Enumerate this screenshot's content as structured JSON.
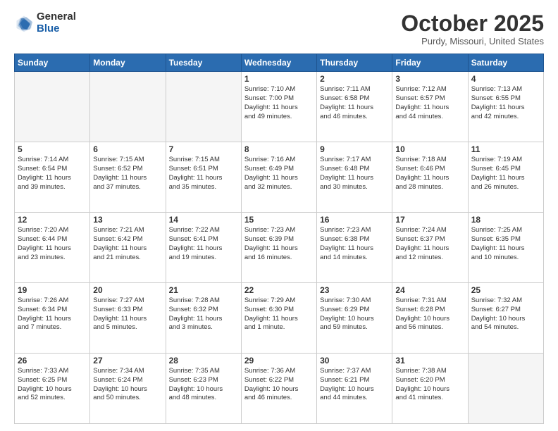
{
  "logo": {
    "general": "General",
    "blue": "Blue"
  },
  "title": "October 2025",
  "location": "Purdy, Missouri, United States",
  "days_of_week": [
    "Sunday",
    "Monday",
    "Tuesday",
    "Wednesday",
    "Thursday",
    "Friday",
    "Saturday"
  ],
  "weeks": [
    [
      {
        "day": "",
        "info": "",
        "empty": true
      },
      {
        "day": "",
        "info": "",
        "empty": true
      },
      {
        "day": "",
        "info": "",
        "empty": true
      },
      {
        "day": "1",
        "info": "Sunrise: 7:10 AM\nSunset: 7:00 PM\nDaylight: 11 hours\nand 49 minutes.",
        "empty": false
      },
      {
        "day": "2",
        "info": "Sunrise: 7:11 AM\nSunset: 6:58 PM\nDaylight: 11 hours\nand 46 minutes.",
        "empty": false
      },
      {
        "day": "3",
        "info": "Sunrise: 7:12 AM\nSunset: 6:57 PM\nDaylight: 11 hours\nand 44 minutes.",
        "empty": false
      },
      {
        "day": "4",
        "info": "Sunrise: 7:13 AM\nSunset: 6:55 PM\nDaylight: 11 hours\nand 42 minutes.",
        "empty": false
      }
    ],
    [
      {
        "day": "5",
        "info": "Sunrise: 7:14 AM\nSunset: 6:54 PM\nDaylight: 11 hours\nand 39 minutes.",
        "empty": false
      },
      {
        "day": "6",
        "info": "Sunrise: 7:15 AM\nSunset: 6:52 PM\nDaylight: 11 hours\nand 37 minutes.",
        "empty": false
      },
      {
        "day": "7",
        "info": "Sunrise: 7:15 AM\nSunset: 6:51 PM\nDaylight: 11 hours\nand 35 minutes.",
        "empty": false
      },
      {
        "day": "8",
        "info": "Sunrise: 7:16 AM\nSunset: 6:49 PM\nDaylight: 11 hours\nand 32 minutes.",
        "empty": false
      },
      {
        "day": "9",
        "info": "Sunrise: 7:17 AM\nSunset: 6:48 PM\nDaylight: 11 hours\nand 30 minutes.",
        "empty": false
      },
      {
        "day": "10",
        "info": "Sunrise: 7:18 AM\nSunset: 6:46 PM\nDaylight: 11 hours\nand 28 minutes.",
        "empty": false
      },
      {
        "day": "11",
        "info": "Sunrise: 7:19 AM\nSunset: 6:45 PM\nDaylight: 11 hours\nand 26 minutes.",
        "empty": false
      }
    ],
    [
      {
        "day": "12",
        "info": "Sunrise: 7:20 AM\nSunset: 6:44 PM\nDaylight: 11 hours\nand 23 minutes.",
        "empty": false
      },
      {
        "day": "13",
        "info": "Sunrise: 7:21 AM\nSunset: 6:42 PM\nDaylight: 11 hours\nand 21 minutes.",
        "empty": false
      },
      {
        "day": "14",
        "info": "Sunrise: 7:22 AM\nSunset: 6:41 PM\nDaylight: 11 hours\nand 19 minutes.",
        "empty": false
      },
      {
        "day": "15",
        "info": "Sunrise: 7:23 AM\nSunset: 6:39 PM\nDaylight: 11 hours\nand 16 minutes.",
        "empty": false
      },
      {
        "day": "16",
        "info": "Sunrise: 7:23 AM\nSunset: 6:38 PM\nDaylight: 11 hours\nand 14 minutes.",
        "empty": false
      },
      {
        "day": "17",
        "info": "Sunrise: 7:24 AM\nSunset: 6:37 PM\nDaylight: 11 hours\nand 12 minutes.",
        "empty": false
      },
      {
        "day": "18",
        "info": "Sunrise: 7:25 AM\nSunset: 6:35 PM\nDaylight: 11 hours\nand 10 minutes.",
        "empty": false
      }
    ],
    [
      {
        "day": "19",
        "info": "Sunrise: 7:26 AM\nSunset: 6:34 PM\nDaylight: 11 hours\nand 7 minutes.",
        "empty": false
      },
      {
        "day": "20",
        "info": "Sunrise: 7:27 AM\nSunset: 6:33 PM\nDaylight: 11 hours\nand 5 minutes.",
        "empty": false
      },
      {
        "day": "21",
        "info": "Sunrise: 7:28 AM\nSunset: 6:32 PM\nDaylight: 11 hours\nand 3 minutes.",
        "empty": false
      },
      {
        "day": "22",
        "info": "Sunrise: 7:29 AM\nSunset: 6:30 PM\nDaylight: 11 hours\nand 1 minute.",
        "empty": false
      },
      {
        "day": "23",
        "info": "Sunrise: 7:30 AM\nSunset: 6:29 PM\nDaylight: 10 hours\nand 59 minutes.",
        "empty": false
      },
      {
        "day": "24",
        "info": "Sunrise: 7:31 AM\nSunset: 6:28 PM\nDaylight: 10 hours\nand 56 minutes.",
        "empty": false
      },
      {
        "day": "25",
        "info": "Sunrise: 7:32 AM\nSunset: 6:27 PM\nDaylight: 10 hours\nand 54 minutes.",
        "empty": false
      }
    ],
    [
      {
        "day": "26",
        "info": "Sunrise: 7:33 AM\nSunset: 6:25 PM\nDaylight: 10 hours\nand 52 minutes.",
        "empty": false
      },
      {
        "day": "27",
        "info": "Sunrise: 7:34 AM\nSunset: 6:24 PM\nDaylight: 10 hours\nand 50 minutes.",
        "empty": false
      },
      {
        "day": "28",
        "info": "Sunrise: 7:35 AM\nSunset: 6:23 PM\nDaylight: 10 hours\nand 48 minutes.",
        "empty": false
      },
      {
        "day": "29",
        "info": "Sunrise: 7:36 AM\nSunset: 6:22 PM\nDaylight: 10 hours\nand 46 minutes.",
        "empty": false
      },
      {
        "day": "30",
        "info": "Sunrise: 7:37 AM\nSunset: 6:21 PM\nDaylight: 10 hours\nand 44 minutes.",
        "empty": false
      },
      {
        "day": "31",
        "info": "Sunrise: 7:38 AM\nSunset: 6:20 PM\nDaylight: 10 hours\nand 41 minutes.",
        "empty": false
      },
      {
        "day": "",
        "info": "",
        "empty": true
      }
    ]
  ]
}
